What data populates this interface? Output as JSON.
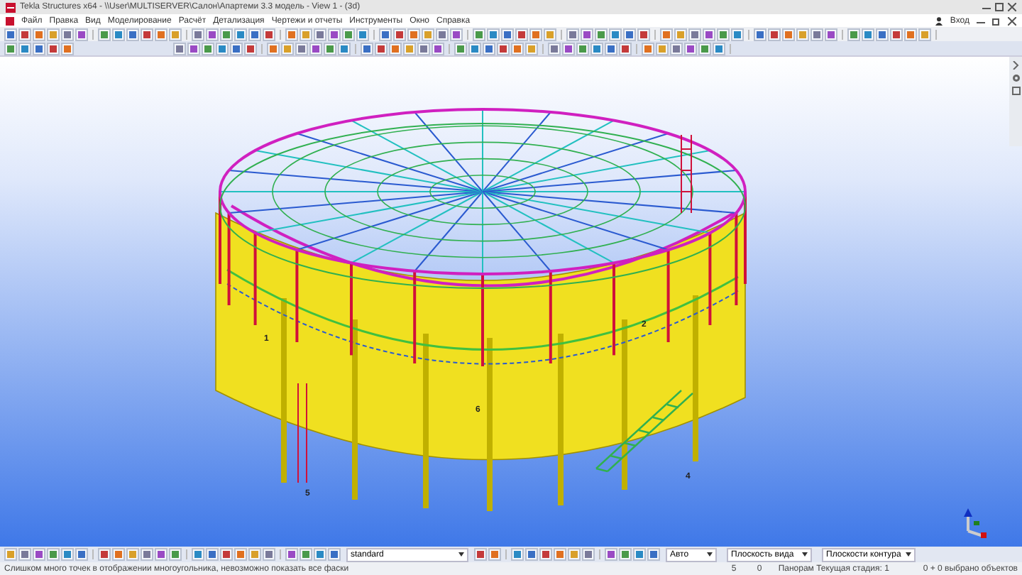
{
  "window": {
    "title": "Tekla Structures x64 - \\\\User\\MULTISERVER\\Салон\\Апартеми 3.3 модель - View 1 - (3d)"
  },
  "menu": [
    "Файл",
    "Правка",
    "Вид",
    "Моделирование",
    "Расчёт",
    "Детализация",
    "Чертежи и отчеты",
    "Инструменты",
    "Окно",
    "Справка"
  ],
  "user": {
    "label": "Вход"
  },
  "model_labels": [
    "1",
    "2",
    "6",
    "5",
    "4"
  ],
  "bottom_toolbar": {
    "view_filter": "standard",
    "snap_mode": "Авто",
    "plane": "Плоскость вида",
    "contour": "Плоскости контура"
  },
  "status_bar": {
    "message": "Слишком много точек в отображении многоугольника, невозможно показать все фаски",
    "field_1": "5",
    "field_2": "0",
    "phase": "Панорам Текущая стадия: 1",
    "selection": "0 + 0 выбрано объектов"
  }
}
